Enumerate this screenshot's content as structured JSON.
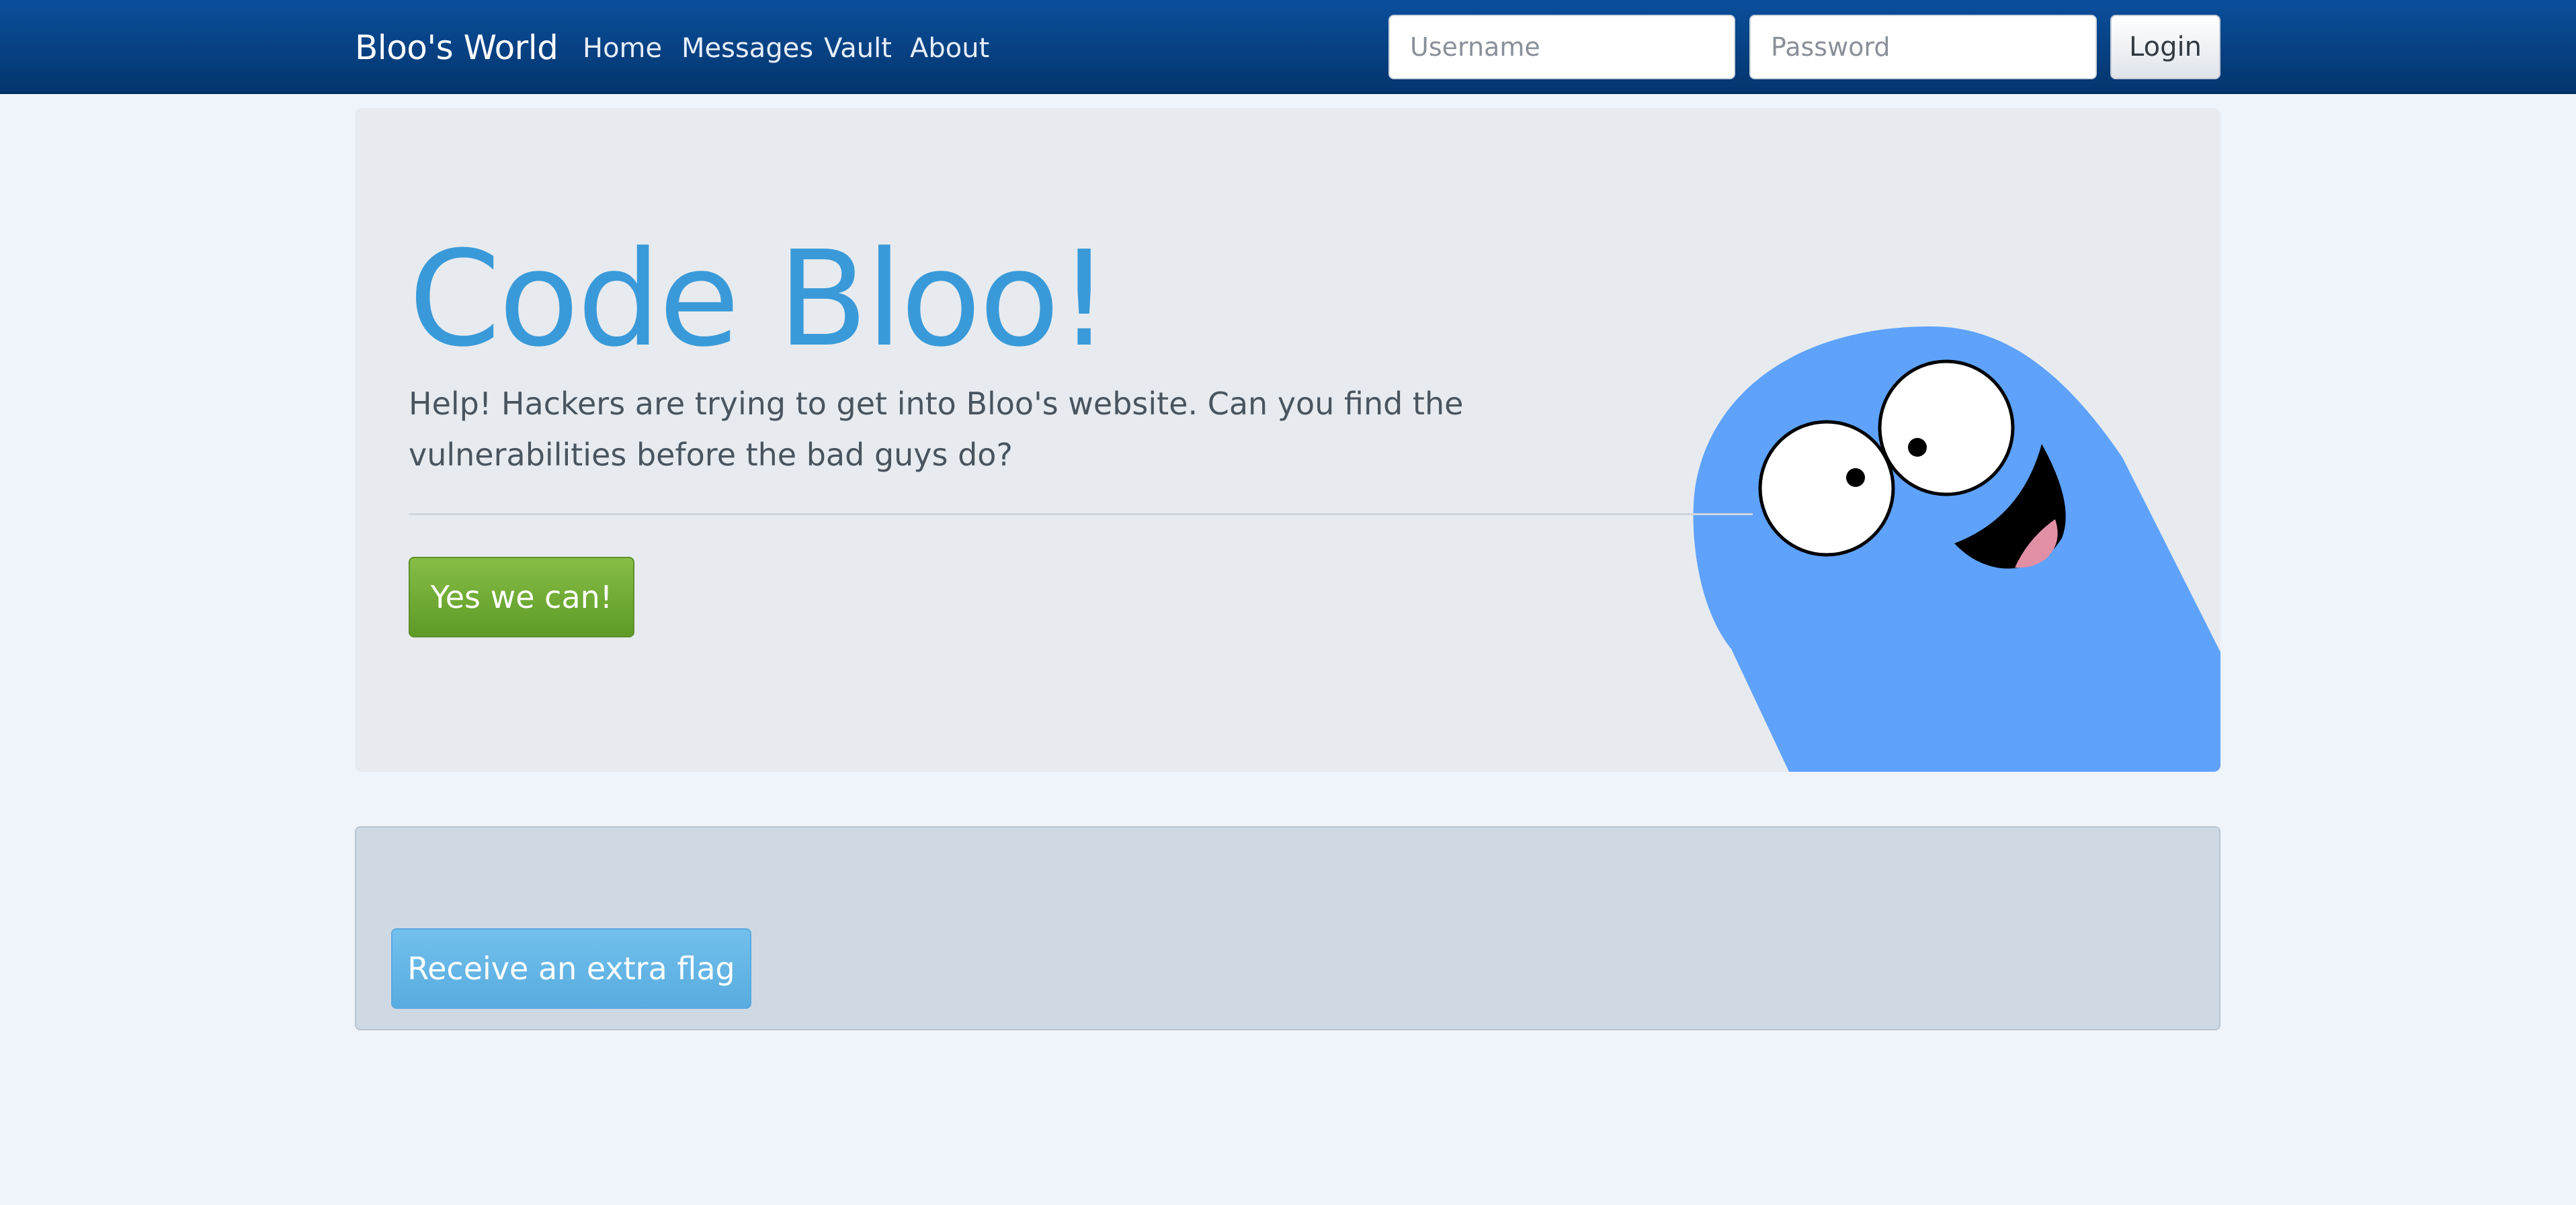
{
  "navbar": {
    "brand": "Bloo's World",
    "links": [
      {
        "label": "Home"
      },
      {
        "label": "Messages"
      },
      {
        "label": "Vault"
      },
      {
        "label": "About"
      }
    ],
    "username_placeholder": "Username",
    "password_placeholder": "Password",
    "login_label": "Login"
  },
  "hero": {
    "title": "Code Bloo!",
    "subtitle": "Help! Hackers are trying to get into Bloo's website. Can you find the vulnerabilities before the bad guys do?",
    "cta_label": "Yes we can!",
    "mascot_icon": "bloo-mascot-icon"
  },
  "flag_panel": {
    "button_label": "Receive an extra flag"
  },
  "colors": {
    "navbar": "#05356d",
    "title": "#3a9ad9",
    "cta": "#6ba830",
    "flag_button": "#62b4e6",
    "mascot": "#5ea2fc",
    "background": "#eff4fb"
  }
}
